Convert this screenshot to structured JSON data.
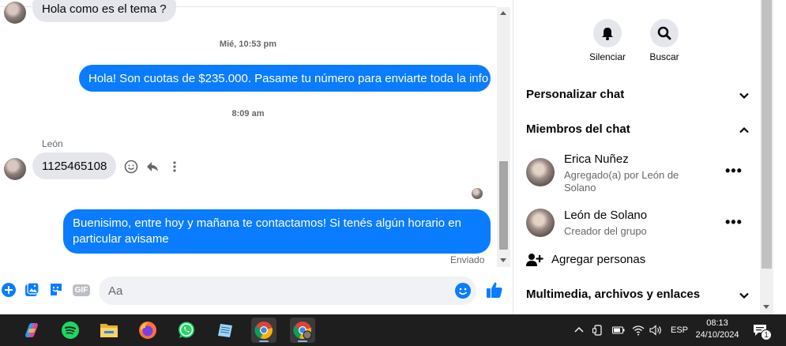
{
  "chat": {
    "prev_message": "Hola como es el tema ?",
    "timestamp_1": "Mié, 10:53 pm",
    "out_message_1": "Hola! Son cuotas de $235.000. Pasame tu número para enviarte toda la info",
    "timestamp_2": "8:09 am",
    "sender_name": "León",
    "in_message": "1125465108",
    "out_message_2": "Buenisimo, entre hoy y mañana te contactamos! Si tenés algún horario en particular avisame",
    "status": "Enviado"
  },
  "composer": {
    "placeholder": "Aa",
    "gif_label": "GIF"
  },
  "info_panel": {
    "actions": [
      {
        "label": "Silenciar",
        "icon": "bell-icon"
      },
      {
        "label": "Buscar",
        "icon": "search-icon"
      }
    ],
    "sections": {
      "customize": "Personalizar chat",
      "members": "Miembros del chat",
      "media": "Multimedia, archivos y enlaces"
    },
    "members": [
      {
        "name": "Erica Nuñez",
        "subtitle": "Agregado(a) por León de Solano"
      },
      {
        "name": "León de Solano",
        "subtitle": "Creador del grupo"
      }
    ],
    "add_people": "Agregar personas"
  },
  "taskbar": {
    "apps": [
      "copilot-icon",
      "spotify-icon",
      "file-explorer-icon",
      "firefox-icon",
      "whatsapp-icon",
      "notepad-icon",
      "chrome-icon",
      "chrome-profile-icon"
    ],
    "language": "ESP",
    "time": "08:13",
    "date": "24/10/2024",
    "notification_count": "1"
  },
  "colors": {
    "messenger_blue": "#0a7cff",
    "bubble_gray": "#e4e6eb",
    "taskbar": "#1e1e1e"
  }
}
